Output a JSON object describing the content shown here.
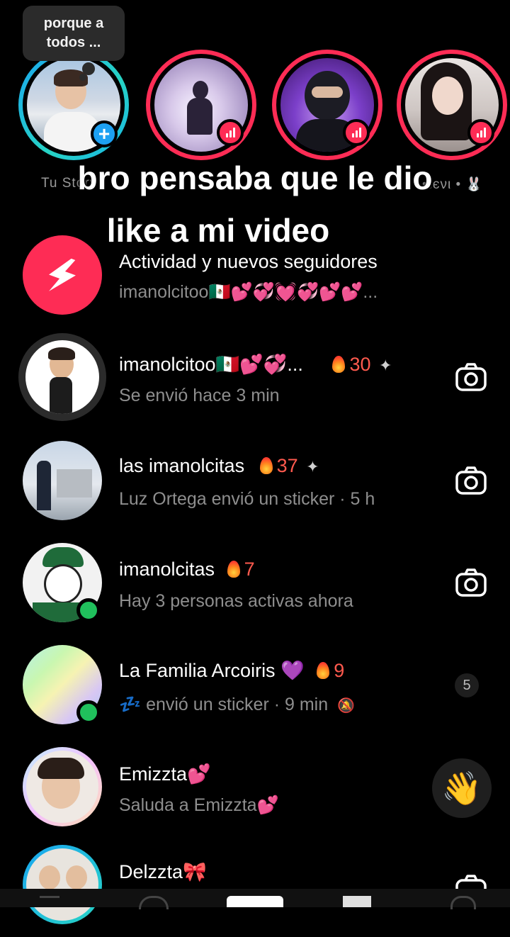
{
  "story_bubble": {
    "text": "porque a todos ..."
  },
  "stories": [
    {
      "label": "Tu Story"
    },
    {
      "label": ""
    },
    {
      "label": ""
    },
    {
      "label": "•ℓєνι • 🐰"
    }
  ],
  "caption": {
    "line1": "bro pensaba que le dio",
    "line2": "like a mi video"
  },
  "chats": [
    {
      "title": "Actividad y nuevos seguidores",
      "subtitle": "imanolcitoo🇲🇽💕💞💓💞💕💕...",
      "streak": "",
      "action": "none"
    },
    {
      "title": "imanolcitoo🇲🇽💕💞...",
      "streak": "30",
      "pinned": true,
      "subtitle": "Se envió hace 3 min",
      "action": "camera"
    },
    {
      "title": "las imanolcitas",
      "streak": "37",
      "pinned": true,
      "subtitle": "Luz Ortega envió un sticker · 5 h",
      "action": "camera"
    },
    {
      "title": "imanolcitas",
      "streak": "7",
      "pinned": false,
      "subtitle": "Hay 3 personas activas ahora",
      "action": "camera"
    },
    {
      "title": "La Familia Arcoiris 💜",
      "streak": "9",
      "pinned": false,
      "subtitle": "💤 envió un sticker · 9 min",
      "unread": "5",
      "action": "badge"
    },
    {
      "title": "Emizzta💕",
      "streak": "",
      "subtitle": "Saluda a Emizzta💕",
      "action": "wave"
    },
    {
      "title": "Delzzta🎀",
      "streak": "",
      "subtitle": "",
      "action": "camera"
    }
  ],
  "icons": {
    "add": "plus-icon",
    "live": "live-bars-icon",
    "camera": "camera-icon",
    "activity": "lightning-icon",
    "streak": "flame-icon",
    "pin": "pin-icon",
    "mute": "bell-off-icon",
    "wave": "waving-hand-icon"
  },
  "colors": {
    "accent": "#fe2c55",
    "story_ring_me": "#1aa6f0",
    "online": "#20c05c",
    "streak": "#ff5a4e"
  }
}
